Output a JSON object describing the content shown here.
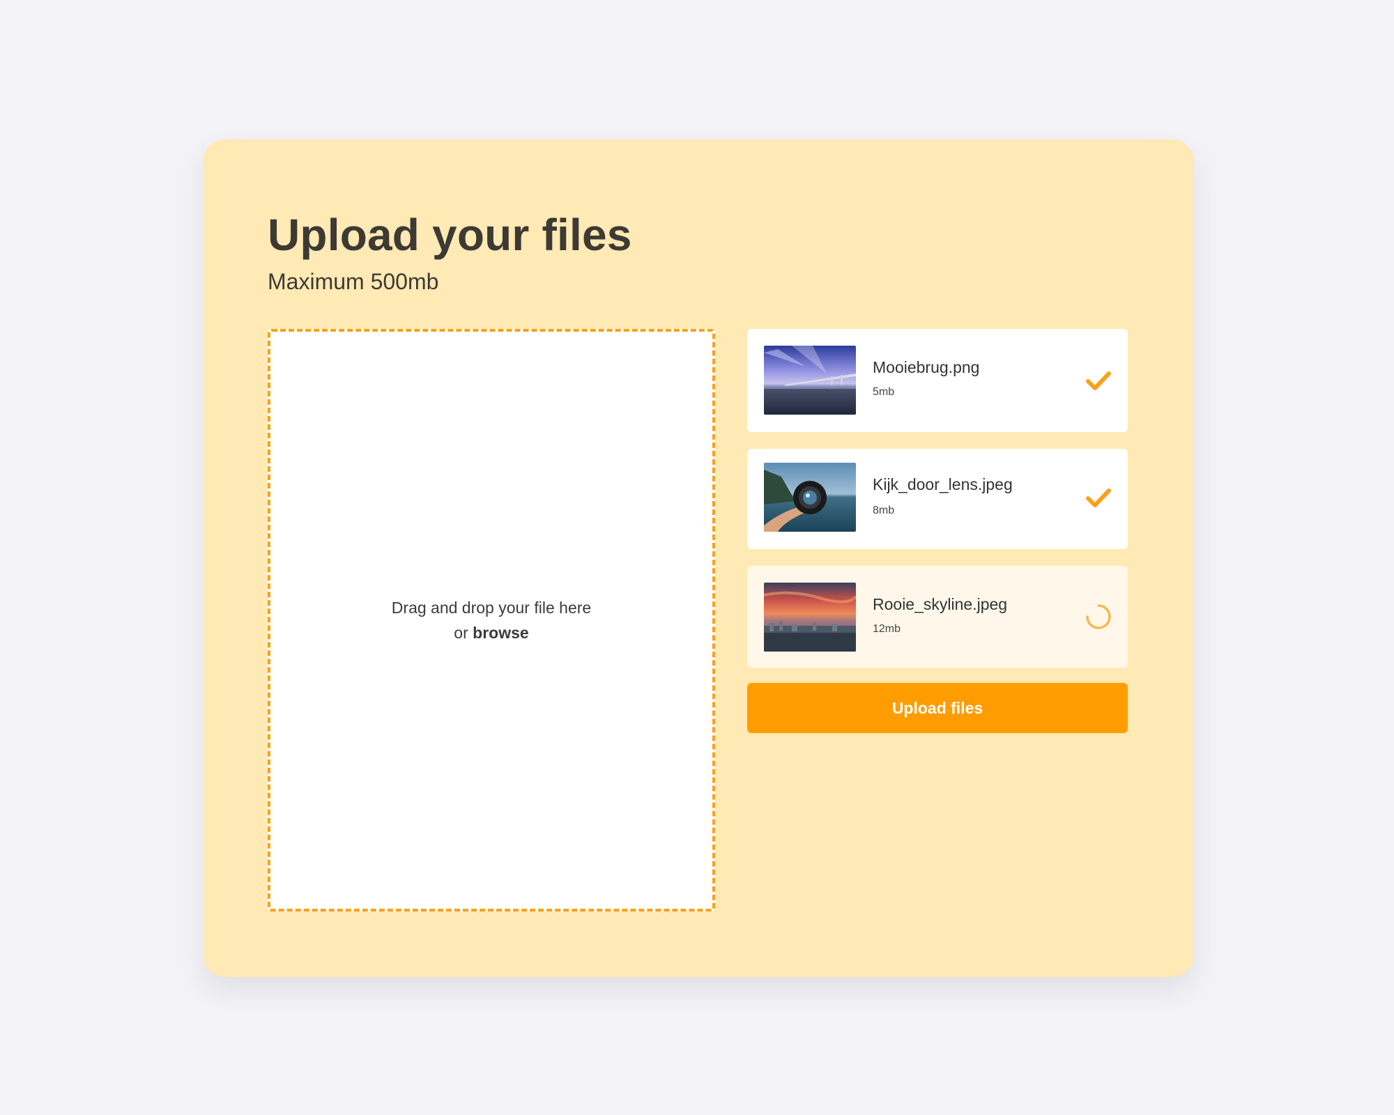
{
  "header": {
    "title": "Upload your files",
    "subtitle": "Maximum 500mb"
  },
  "dropzone": {
    "line1": "Drag and drop your file here",
    "line2_prefix": "or",
    "browse_label": "browse"
  },
  "files": [
    {
      "name": "Mooiebrug.png",
      "size": "5mb",
      "status": "complete",
      "status_icon": "check-icon",
      "thumbnail": "bridge-photo"
    },
    {
      "name": "Kijk_door_lens.jpeg",
      "size": "8mb",
      "status": "complete",
      "status_icon": "check-icon",
      "thumbnail": "lens-photo"
    },
    {
      "name": "Rooie_skyline.jpeg",
      "size": "12mb",
      "status": "uploading",
      "status_icon": "spinner-icon",
      "thumbnail": "skyline-photo"
    }
  ],
  "actions": {
    "upload_label": "Upload files"
  },
  "colors": {
    "page_background": "#f3f3f7",
    "card_background": "#ffe9b4",
    "accent": "#ff9d00",
    "dashed_border": "#f7a21b",
    "pending_row": "#fff8ea"
  }
}
